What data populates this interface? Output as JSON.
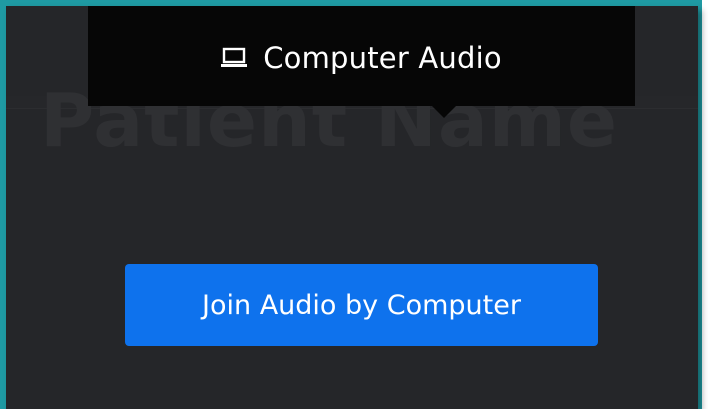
{
  "tooltip": {
    "icon": "laptop-icon",
    "label": "Computer Audio"
  },
  "background": {
    "watermark_text": "Patient Name"
  },
  "join_button": {
    "label": "Join Audio by Computer"
  },
  "colors": {
    "accent": "#0e72ed",
    "panel_bg": "#252629",
    "tooltip_bg": "#060606",
    "frame_border": "#1f9aa3"
  }
}
